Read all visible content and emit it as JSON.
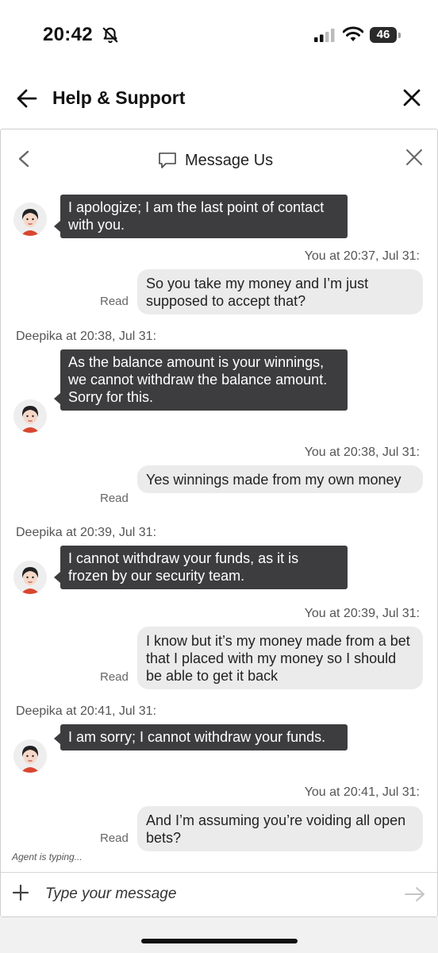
{
  "status_bar": {
    "time": "20:42",
    "battery": "46",
    "icons": [
      "bell-slash-icon",
      "cellular-signal-icon",
      "wifi-icon",
      "battery-icon"
    ]
  },
  "header": {
    "title": "Help & Support",
    "back_icon": "arrow-left-icon",
    "close_icon": "close-icon"
  },
  "chat": {
    "title": "Message Us",
    "back_icon": "chevron-left-icon",
    "title_icon": "chat-bubble-icon",
    "close_icon": "close-icon",
    "messages": [
      {
        "sender": "agent",
        "text": "I apologize; I am the last point of contact with you."
      },
      {
        "sender": "user",
        "meta": "You at 20:37, Jul 31:",
        "text": "So you take my money and I’m just supposed to accept that?",
        "status": "Read"
      },
      {
        "sender": "agent",
        "meta": "Deepika at 20:38, Jul 31:",
        "text": "As the balance amount is your winnings, we cannot withdraw the balance amount. Sorry for this."
      },
      {
        "sender": "user",
        "meta": "You at 20:38, Jul 31:",
        "text": "Yes winnings made from my own money",
        "status": "Read"
      },
      {
        "sender": "agent",
        "meta": "Deepika at 20:39, Jul 31:",
        "text": "I cannot withdraw your funds, as it is frozen by our security team."
      },
      {
        "sender": "user",
        "meta": "You at 20:39, Jul 31:",
        "text": "I know but it’s my money made from a bet that I placed with my money so I should be able to get it back",
        "status": "Read"
      },
      {
        "sender": "agent",
        "meta": "Deepika at 20:41, Jul 31:",
        "text": "I am sorry; I cannot withdraw your funds."
      },
      {
        "sender": "user",
        "meta": "You at 20:41, Jul 31:",
        "text": "And I’m assuming you’re voiding all open bets?",
        "status": "Read"
      }
    ],
    "typing_indicator": "Agent is typing...",
    "input_placeholder": "Type your message",
    "plus_icon": "plus-icon",
    "send_icon": "send-arrow-icon"
  }
}
